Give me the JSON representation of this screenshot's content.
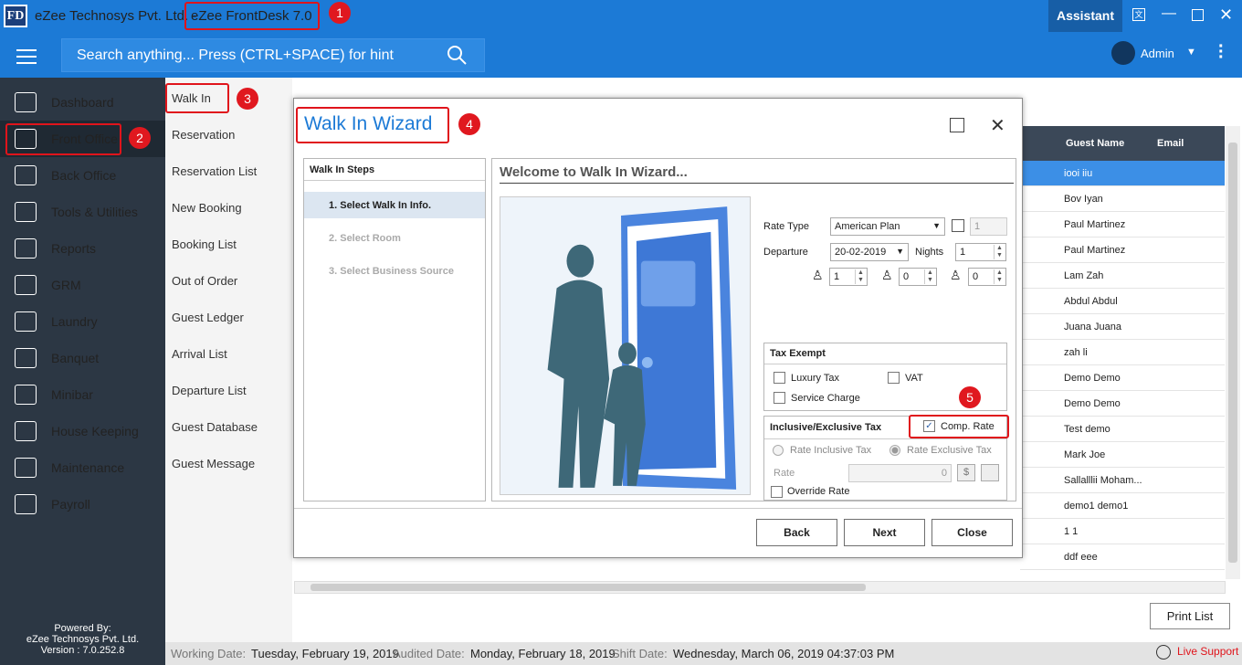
{
  "titlebar": {
    "logo": "FD",
    "company": "eZee Technosys Pvt. Ltd. -",
    "app": "eZee FrontDesk 7.0",
    "assistant": "Assistant"
  },
  "search": {
    "placeholder": "Search anything... Press (CTRL+SPACE) for hint"
  },
  "user": {
    "name": "Admin"
  },
  "sidebar": {
    "items": [
      {
        "label": "Dashboard",
        "icon": "chart-icon"
      },
      {
        "label": "Front Office",
        "icon": "reception-icon"
      },
      {
        "label": "Back Office",
        "icon": "building-icon"
      },
      {
        "label": "Tools & Utilities",
        "icon": "tools-icon"
      },
      {
        "label": "Reports",
        "icon": "report-icon"
      },
      {
        "label": "GRM",
        "icon": "grm-icon"
      },
      {
        "label": "Laundry",
        "icon": "iron-icon"
      },
      {
        "label": "Banquet",
        "icon": "cutlery-icon"
      },
      {
        "label": "Minibar",
        "icon": "fridge-icon"
      },
      {
        "label": "House Keeping",
        "icon": "broom-icon"
      },
      {
        "label": "Maintenance",
        "icon": "worker-icon"
      },
      {
        "label": "Payroll",
        "icon": "payroll-icon"
      }
    ],
    "powered": [
      "Powered By:",
      "eZee Technosys Pvt. Ltd.",
      "Version : 7.0.252.8"
    ]
  },
  "submenu": [
    "Walk In",
    "Reservation",
    "Reservation List",
    "New Booking",
    "Booking List",
    "Out of Order",
    "Guest Ledger",
    "Arrival List",
    "Departure List",
    "Guest Database",
    "Guest Message"
  ],
  "badges": [
    "1",
    "2",
    "3",
    "4",
    "5"
  ],
  "list": {
    "columns": [
      "Guest Name",
      "Email"
    ],
    "guests": [
      "iooi iiu",
      "Bov Iyan",
      "Paul Martinez",
      "Paul Martinez",
      "Lam Zah",
      "Abdul Abdul",
      "Juana Juana",
      "zah li",
      "Demo Demo",
      "Demo Demo",
      "Test demo",
      "Mark Joe",
      "Sallalllii Moham...",
      "demo1 demo1",
      "1 1",
      "ddf eee"
    ],
    "print": "Print List"
  },
  "statusbar": {
    "working_label": "Working Date:",
    "working": "Tuesday, February 19, 2019",
    "audited_label": "Audited Date:",
    "audited": "Monday, February 18, 2019",
    "shift_label": "Shift Date:",
    "shift": "Wednesday, March 06, 2019 04:37:03 PM",
    "live": "Live Support"
  },
  "wizard": {
    "title": "Walk In Wizard",
    "steps_head": "Walk In Steps",
    "steps": [
      "1.  Select Walk In Info.",
      "2.  Select Room",
      "3.  Select Business Source"
    ],
    "welcome": "Welcome to Walk In Wizard...",
    "rate_type_label": "Rate Type",
    "rate_type": "American Plan",
    "rate_qty": "1",
    "departure_label": "Departure",
    "departure": "20-02-2019",
    "nights_label": "Nights",
    "nights": "1",
    "adults": "1",
    "children": "0",
    "infants": "0",
    "tax_head": "Tax Exempt",
    "luxury": "Luxury Tax",
    "vat": "VAT",
    "service": "Service Charge",
    "incl_head": "Inclusive/Exclusive Tax",
    "comp": "Comp. Rate",
    "rate_incl": "Rate Inclusive Tax",
    "rate_excl": "Rate Exclusive Tax",
    "rate_label": "Rate",
    "rate": "0",
    "override": "Override Rate",
    "back": "Back",
    "next": "Next",
    "close": "Close"
  }
}
